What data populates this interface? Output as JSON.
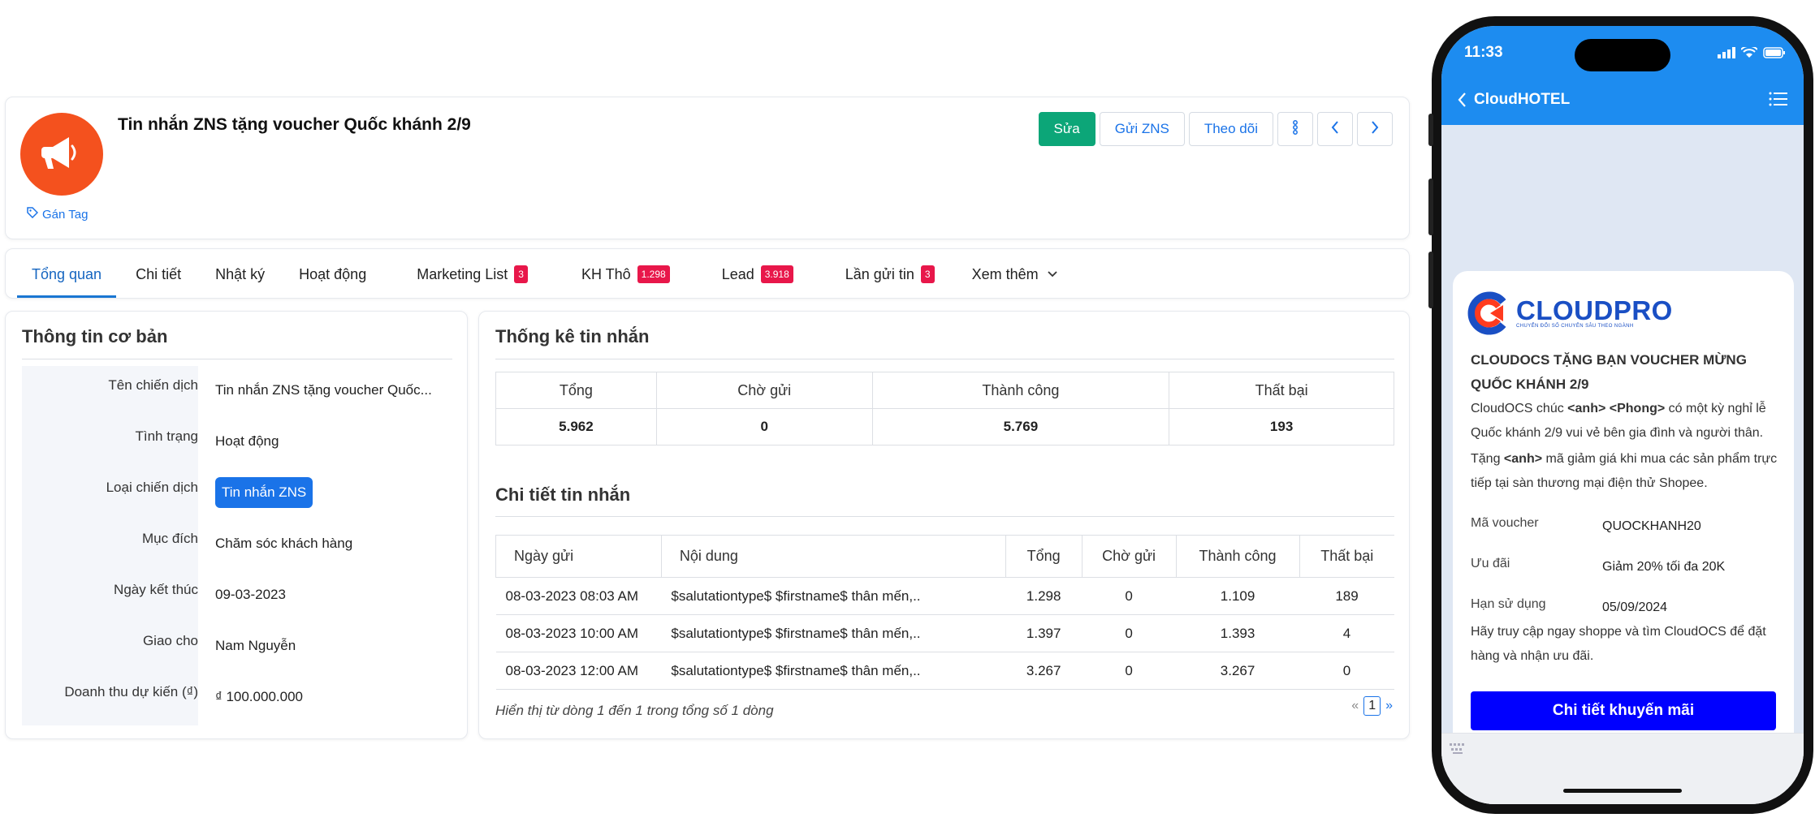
{
  "campaign": {
    "title": "Tin nhắn ZNS tặng voucher Quốc khánh 2/9",
    "tag_label": "Gán Tag"
  },
  "header_actions": {
    "edit": "Sửa",
    "send": "Gửi ZNS",
    "follow": "Theo dõi"
  },
  "tabs": [
    {
      "label": "Tổng quan",
      "badge": ""
    },
    {
      "label": "Chi tiết",
      "badge": ""
    },
    {
      "label": "Nhật ký",
      "badge": ""
    },
    {
      "label": "Hoạt động",
      "badge": ""
    },
    {
      "label": "Marketing List",
      "badge": "3"
    },
    {
      "label": "KH Thô",
      "badge": "1.298"
    },
    {
      "label": "Lead",
      "badge": "3.918"
    },
    {
      "label": "Lần gửi tin",
      "badge": "3"
    },
    {
      "label": "Xem thêm",
      "badge": ""
    }
  ],
  "basic_info": {
    "title": "Thông tin cơ bản",
    "rows": [
      {
        "label": "Tên chiến dịch",
        "value": "Tin nhắn ZNS tặng voucher Quốc..."
      },
      {
        "label": "Tình trạng",
        "value": "Hoạt động"
      },
      {
        "label": "Loại chiến dịch",
        "value": "Tin nhắn ZNS"
      },
      {
        "label": "Mục đích",
        "value": "Chăm sóc khách hàng"
      },
      {
        "label": "Ngày kết thúc",
        "value": "09-03-2023"
      },
      {
        "label": "Giao cho",
        "value": "Nam Nguyễn"
      },
      {
        "label": "Doanh thu dự kiến (₫)",
        "value": "₫ 100.000.000"
      }
    ]
  },
  "stats": {
    "title": "Thống kê tin nhắn",
    "headers": [
      "Tổng",
      "Chờ gửi",
      "Thành công",
      "Thất bại"
    ],
    "values": [
      "5.962",
      "0",
      "5.769",
      "193"
    ]
  },
  "details": {
    "title": "Chi tiết tin nhắn",
    "headers": [
      "Ngày gửi",
      "Nội dung",
      "Tổng",
      "Chờ gửi",
      "Thành công",
      "Thất bại"
    ],
    "rows": [
      [
        "08-03-2023 08:03 AM",
        "$salutationtype$ $firstname$ thân mến,..",
        "1.298",
        "0",
        "1.109",
        "189"
      ],
      [
        "08-03-2023 10:00 AM",
        "$salutationtype$ $firstname$ thân mến,..",
        "1.397",
        "0",
        "1.393",
        "4"
      ],
      [
        "08-03-2023 12:00 AM",
        "$salutationtype$ $firstname$ thân mến,..",
        "3.267",
        "0",
        "3.267",
        "0"
      ]
    ],
    "pager_text": "Hiển thị từ dòng 1 đến 1 trong tổng số 1 dòng",
    "pager_prev": "«",
    "pager_page": "1",
    "pager_next": "»"
  },
  "phone": {
    "time": "11:33",
    "chat_title": "CloudHOTEL",
    "brand": "CLOUDPRO",
    "brand_slogan": "CHUYỂN ĐỔI SỐ CHUYÊN SÂU THEO NGÀNH",
    "heading": "CLOUDOCS TẶNG BẠN VOUCHER MỪNG QUỐC KHÁNH 2/9",
    "para1_a": "CloudOCS chúc ",
    "para1_b": "<anh> <Phong>",
    "para1_c": " có một kỳ nghỉ lễ Quốc khánh 2/9 vui vẻ bên gia đình và người thân.",
    "para2_a": "Tặng ",
    "para2_b": "<anh>",
    "para2_c": " mã giảm giá khi mua các sản phẩm trực tiếp tại sàn thương mại điện thử Shopee.",
    "kv": [
      {
        "k": "Mã voucher",
        "v": "QUOCKHANH20"
      },
      {
        "k": "Ưu đãi",
        "v": "Giảm 20% tối đa 20K"
      },
      {
        "k": "Hạn sử dụng",
        "v": "05/09/2024"
      }
    ],
    "para3": "Hãy truy cập ngay shoppe và tìm CloudOCS để đặt hàng và nhận ưu đãi.",
    "cta": "Chi tiết khuyến mãi"
  },
  "colors": {
    "accent": "#1a73e8",
    "edit_button": "#0ca678",
    "badge": "#e8174a",
    "logo_bg": "#f4511e",
    "phone_header": "#1d8cf0",
    "cta": "#0000ff"
  }
}
